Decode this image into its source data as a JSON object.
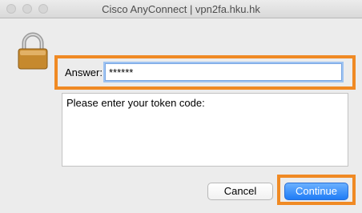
{
  "window": {
    "title": "Cisco AnyConnect | vpn2fa.hku.hk"
  },
  "form": {
    "answer_label": "Answer:",
    "answer_value": "******",
    "message": "Please enter your token code:"
  },
  "buttons": {
    "cancel": "Cancel",
    "continue": "Continue"
  },
  "icons": {
    "lock": "padlock-icon"
  },
  "colors": {
    "highlight": "#f08a24",
    "accent": "#1f7cf6"
  }
}
